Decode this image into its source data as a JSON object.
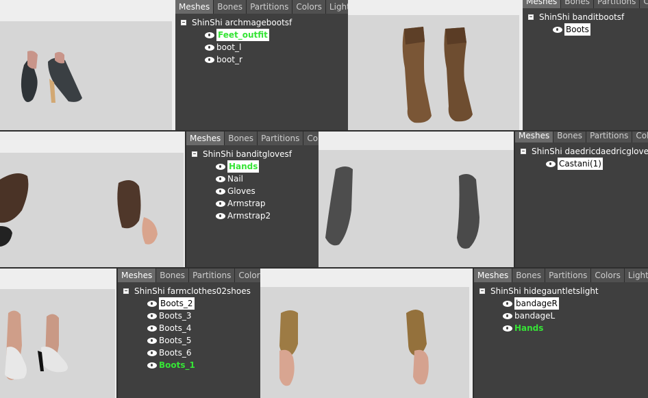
{
  "tabs": {
    "p1": [
      "Meshes",
      "Bones",
      "Partitions",
      "Colors",
      "Lights"
    ],
    "p2": [
      "Meshes",
      "Bones",
      "Partitions",
      "Colors"
    ],
    "p3": [
      "Meshes",
      "Bones",
      "Partitions",
      "Colo"
    ],
    "p4": [
      "Meshes",
      "Bones",
      "Partitions",
      "Colo"
    ],
    "p5": [
      "Meshes",
      "Bones",
      "Partitions",
      "Colors"
    ],
    "p6": [
      "Meshes",
      "Bones",
      "Partitions",
      "Colors",
      "Lights"
    ]
  },
  "p1": {
    "root": "ShinShi archmagebootsf",
    "items": [
      "Feet_outfit",
      "boot_l",
      "boot_r"
    ]
  },
  "p2": {
    "root": "ShinShi banditbootsf",
    "items": [
      "Boots"
    ]
  },
  "p3": {
    "root": "ShinShi banditglovesf",
    "items": [
      "Hands",
      "Nail",
      "Gloves",
      "Armstrap",
      "Armstrap2"
    ]
  },
  "p4": {
    "root": "ShinShi daedricdaedricglovesf",
    "items": [
      "Castani(1)"
    ]
  },
  "p5": {
    "root": "ShinShi farmclothes02shoes",
    "items": [
      "Boots_2",
      "Boots_3",
      "Boots_4",
      "Boots_5",
      "Boots_6",
      "Boots_1"
    ]
  },
  "p6": {
    "root": "ShinShi hidegauntletslight",
    "items": [
      "bandageR",
      "bandageL",
      "Hands"
    ]
  }
}
